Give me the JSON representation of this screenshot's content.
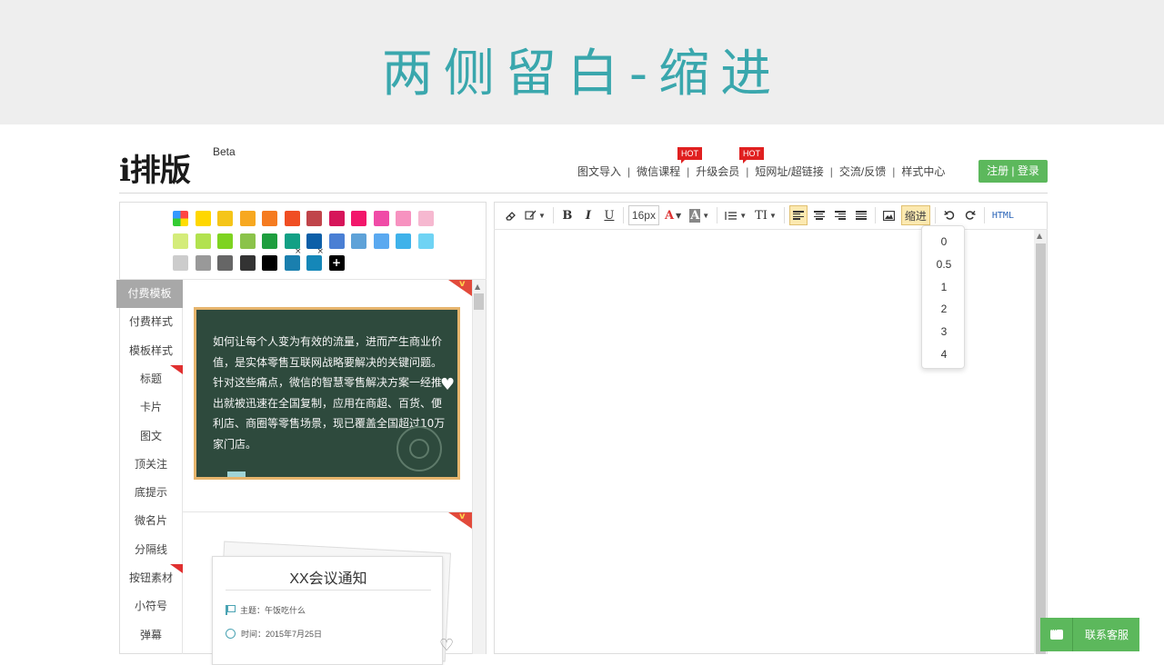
{
  "slide": {
    "title": "两侧留白-缩进"
  },
  "header": {
    "logo_main": "i排版",
    "logo_beta": "Beta",
    "nav": [
      "图文导入",
      "微信课程",
      "升级会员",
      "短网址/超链接",
      "交流/反馈",
      "样式中心"
    ],
    "hot_badge": "HOT",
    "login_label": "注册 | 登录"
  },
  "palette": {
    "rows": [
      [
        "rainbow",
        "#ffd700",
        "#f5c518",
        "#f7a820",
        "#f57b20",
        "#f04e23",
        "#c0444a",
        "#d6155a",
        "#f2176b",
        "#f04ba7",
        "#f792c0",
        "#f6b8d0"
      ],
      [
        "#d4ec7a",
        "#b2e24f",
        "#7ed321",
        "#8bc34a",
        "#1e9e3e",
        "#13a085",
        "#0d5fa8",
        "#4a7fd4",
        "#5ea2d8",
        "#5aa9f0",
        "#3fb2ea",
        "#6fd3f4"
      ],
      [
        "#cccccc",
        "#999999",
        "#666666",
        "#333333",
        "#000000",
        "#1a7fae",
        "#1587b8",
        "#000000"
      ]
    ]
  },
  "categories": [
    "付费模板",
    "付费样式",
    "模板样式",
    "标题",
    "卡片",
    "图文",
    "顶关注",
    "底提示",
    "微名片",
    "分隔线",
    "按钮素材",
    "小符号",
    "弹幕"
  ],
  "template_card": {
    "text": "如何让每个人变为有效的流量，进而产生商业价值，是实体零售互联网战略要解决的关键问题。针对这些痛点，微信的智慧零售解决方案一经推出就被迅速在全国复制，应用在商超、百货、便利店、商圈等零售场景，现已覆盖全国超过10万家门店。"
  },
  "notice_card": {
    "title": "XX会议通知",
    "subject": "主题：午饭吃什么",
    "time": "时间：2015年7月25日"
  },
  "toolbar": {
    "font_size": "16px",
    "indent_label": "缩进",
    "html_label": "HTML",
    "font_color_glyph": "A",
    "bg_color_glyph": "A",
    "heading_glyph": "TI",
    "bold": "B",
    "italic": "I",
    "underline": "U"
  },
  "indent_options": [
    "0",
    "0.5",
    "1",
    "2",
    "3",
    "4"
  ],
  "service": {
    "label": "联系客服"
  }
}
